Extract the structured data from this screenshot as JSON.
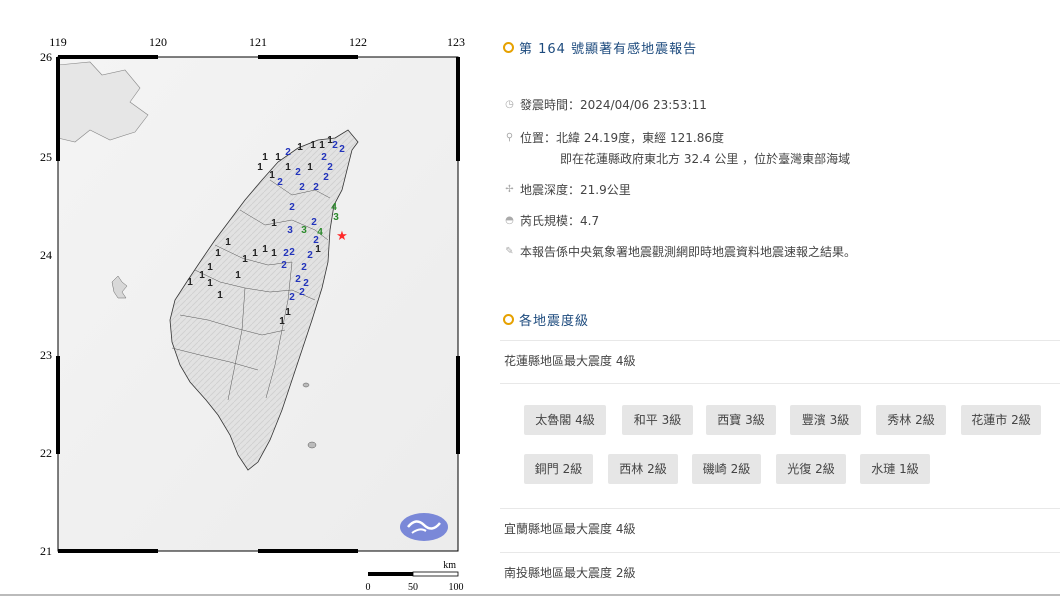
{
  "map": {
    "lon_labels": [
      "119",
      "120",
      "121",
      "122",
      "123"
    ],
    "lat_labels": [
      "26",
      "25",
      "24",
      "23",
      "22",
      "21"
    ],
    "scale": {
      "unit": "km",
      "labels": [
        "0",
        "50",
        "100"
      ]
    },
    "epicenter_color": "#ff2a2a",
    "intensity_marks": [
      {
        "v": "1",
        "c": "#222"
      },
      {
        "v": "1",
        "c": "#222"
      },
      {
        "v": "2",
        "c": "#2233bb"
      },
      {
        "v": "1",
        "c": "#222"
      },
      {
        "v": "1",
        "c": "#222"
      },
      {
        "v": "1",
        "c": "#222"
      },
      {
        "v": "1",
        "c": "#222"
      },
      {
        "v": "2",
        "c": "#2233bb"
      },
      {
        "v": "1",
        "c": "#222"
      },
      {
        "v": "1",
        "c": "#222"
      },
      {
        "v": "2",
        "c": "#2233bb"
      },
      {
        "v": "1",
        "c": "#222"
      },
      {
        "v": "2",
        "c": "#2233bb"
      },
      {
        "v": "1",
        "c": "#222"
      },
      {
        "v": "2",
        "c": "#2233bb"
      },
      {
        "v": "2",
        "c": "#2233bb"
      },
      {
        "v": "2",
        "c": "#2233bb"
      },
      {
        "v": "2",
        "c": "#2233bb"
      },
      {
        "v": "2",
        "c": "#2233bb"
      },
      {
        "v": "2",
        "c": "#2233bb"
      },
      {
        "v": "1",
        "c": "#222"
      },
      {
        "v": "3",
        "c": "#2233bb"
      },
      {
        "v": "2",
        "c": "#2233bb"
      },
      {
        "v": "4",
        "c": "#2a8a2a"
      },
      {
        "v": "3",
        "c": "#2a8a2a"
      },
      {
        "v": "1",
        "c": "#222"
      },
      {
        "v": "2",
        "c": "#2233bb"
      },
      {
        "v": "2",
        "c": "#2233bb"
      },
      {
        "v": "3",
        "c": "#2a8a2a"
      },
      {
        "v": "4",
        "c": "#2a8a2a"
      },
      {
        "v": "2",
        "c": "#2233bb"
      },
      {
        "v": "1",
        "c": "#222"
      },
      {
        "v": "2",
        "c": "#2233bb"
      },
      {
        "v": "2",
        "c": "#2233bb"
      },
      {
        "v": "2",
        "c": "#2233bb"
      },
      {
        "v": "2",
        "c": "#2233bb"
      },
      {
        "v": "2",
        "c": "#2233bb"
      },
      {
        "v": "2",
        "c": "#2233bb"
      },
      {
        "v": "1",
        "c": "#222"
      },
      {
        "v": "1",
        "c": "#222"
      },
      {
        "v": "1",
        "c": "#222"
      },
      {
        "v": "1",
        "c": "#222"
      },
      {
        "v": "1",
        "c": "#222"
      },
      {
        "v": "1",
        "c": "#222"
      },
      {
        "v": "1",
        "c": "#222"
      },
      {
        "v": "1",
        "c": "#222"
      },
      {
        "v": "1",
        "c": "#222"
      },
      {
        "v": "1",
        "c": "#222"
      },
      {
        "v": "1",
        "c": "#222"
      },
      {
        "v": "1",
        "c": "#222"
      },
      {
        "v": "1",
        "c": "#222"
      },
      {
        "v": "2",
        "c": "#2233bb"
      },
      {
        "v": "2",
        "c": "#2233bb"
      }
    ]
  },
  "report": {
    "title": "第 164 號顯著有感地震報告",
    "time_label": "發震時間：2024/04/06 23:53:11",
    "location_label": "位置：北緯 24.19度，東經 121.86度",
    "location_detail": "即在花蓮縣政府東北方 32.4 公里 ，位於臺灣東部海域",
    "depth_label": "地震深度：21.9公里",
    "magnitude_label": "芮氏規模：4.7",
    "note": "本報告係中央氣象署地震觀測網即時地震資料地震速報之結果。",
    "icons": [
      "clock-icon",
      "location-pin-icon",
      "depth-icon",
      "magnitude-icon",
      "pencil-icon"
    ]
  },
  "intensity_section": {
    "title": "各地震度級",
    "accent": "#e6a100",
    "regions": [
      {
        "label": "花蓮縣地區最大震度 4級",
        "stations": [
          "太魯閣 4級",
          "和平 3級",
          "西寶 3級",
          "豐濱 3級",
          "秀林 2級",
          "花蓮市 2級",
          "銅門 2級",
          "西林 2級",
          "磯崎 2級",
          "光復 2級",
          "水璉 1級"
        ]
      },
      {
        "label": "宜蘭縣地區最大震度 4級"
      },
      {
        "label": "南投縣地區最大震度 2級"
      }
    ]
  }
}
